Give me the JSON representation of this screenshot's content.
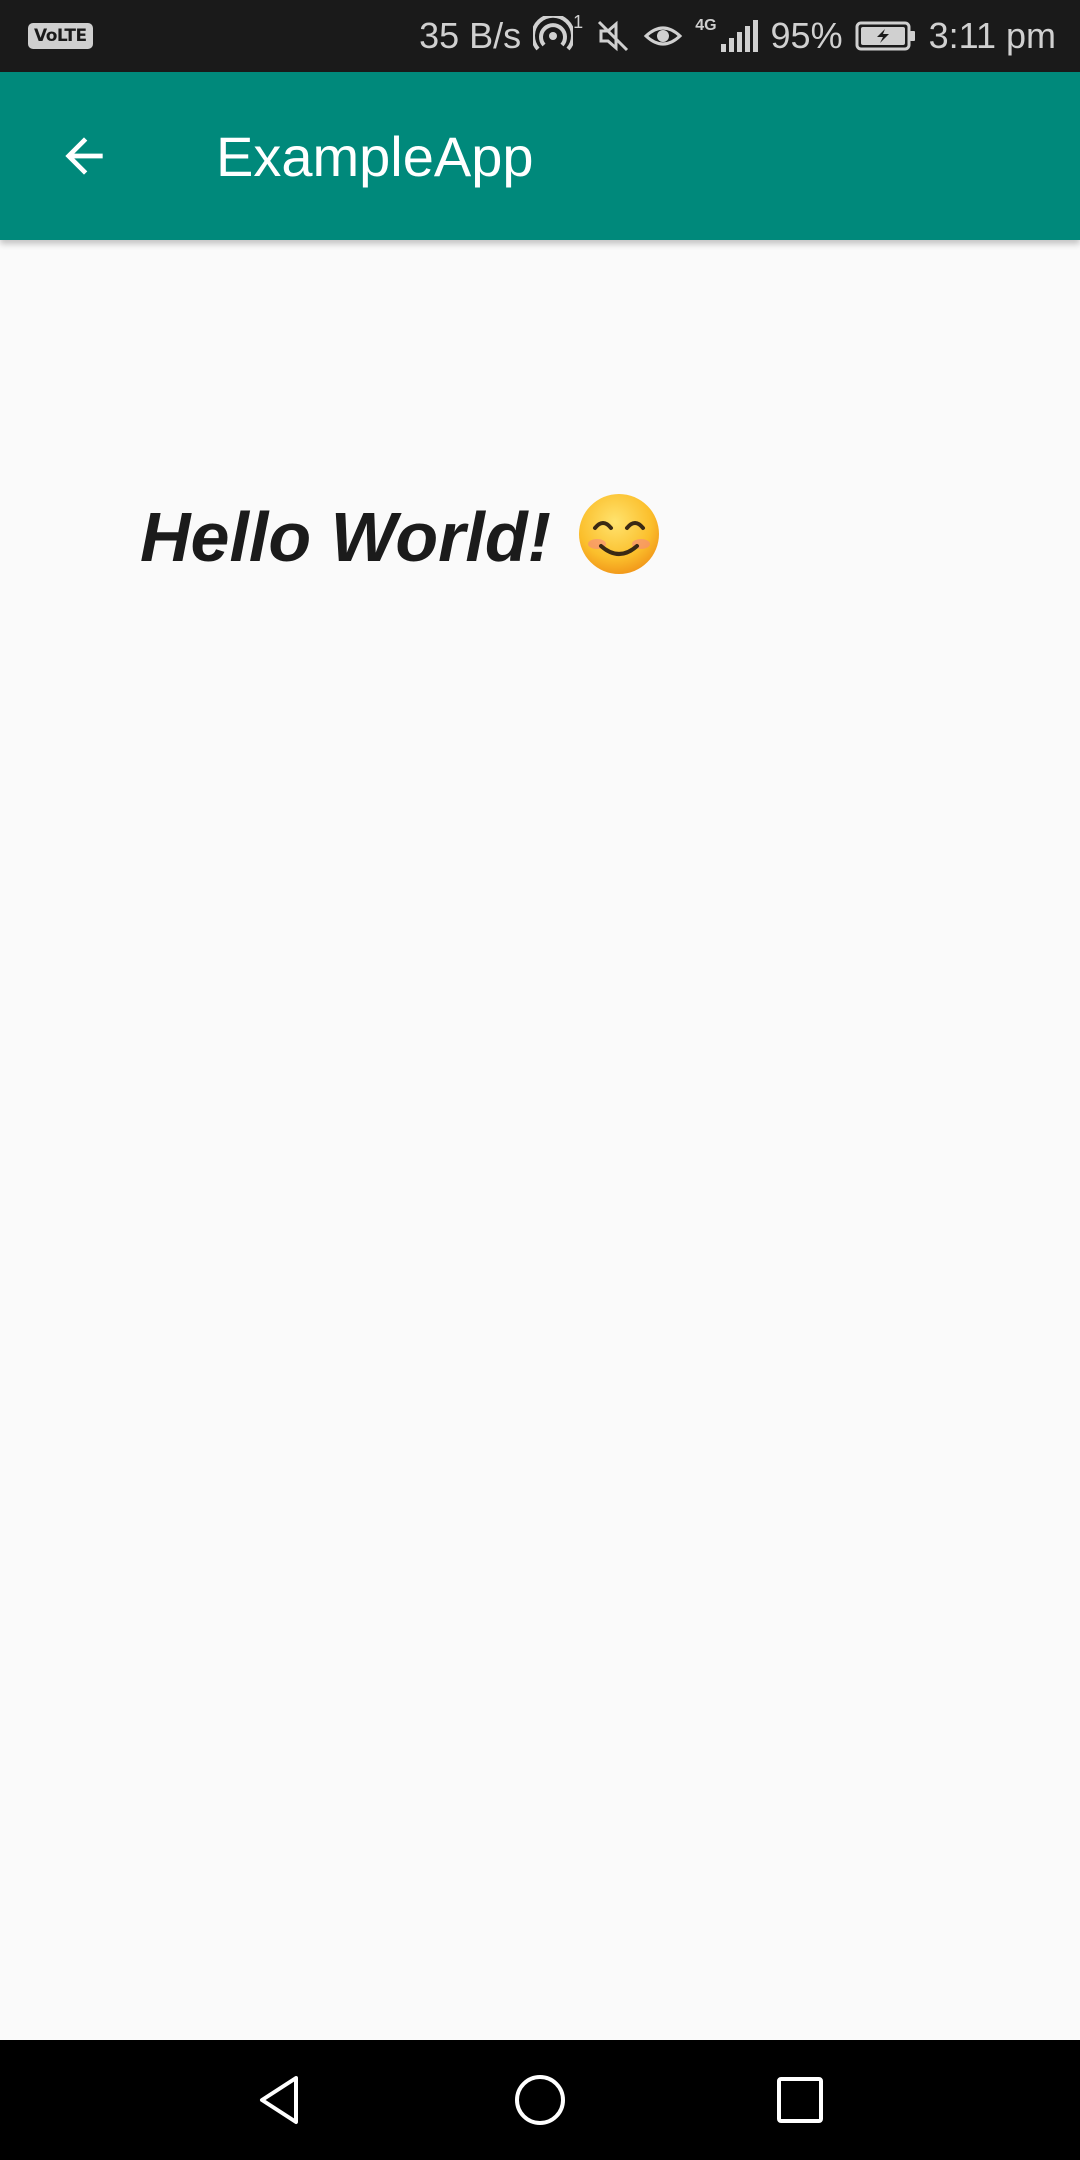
{
  "status_bar": {
    "volte": "VoLTE",
    "net_speed": "35 B/s",
    "hotspot_sup": "1",
    "network_type": "4G",
    "battery": "95%",
    "time": "3:11 pm"
  },
  "app_bar": {
    "title": "ExampleApp",
    "color": "#00897b"
  },
  "content": {
    "greeting": "Hello World!",
    "emoji": "smiling-face-icon"
  },
  "nav_bar": {
    "back": "back-icon",
    "home": "home-icon",
    "recents": "recents-icon"
  }
}
